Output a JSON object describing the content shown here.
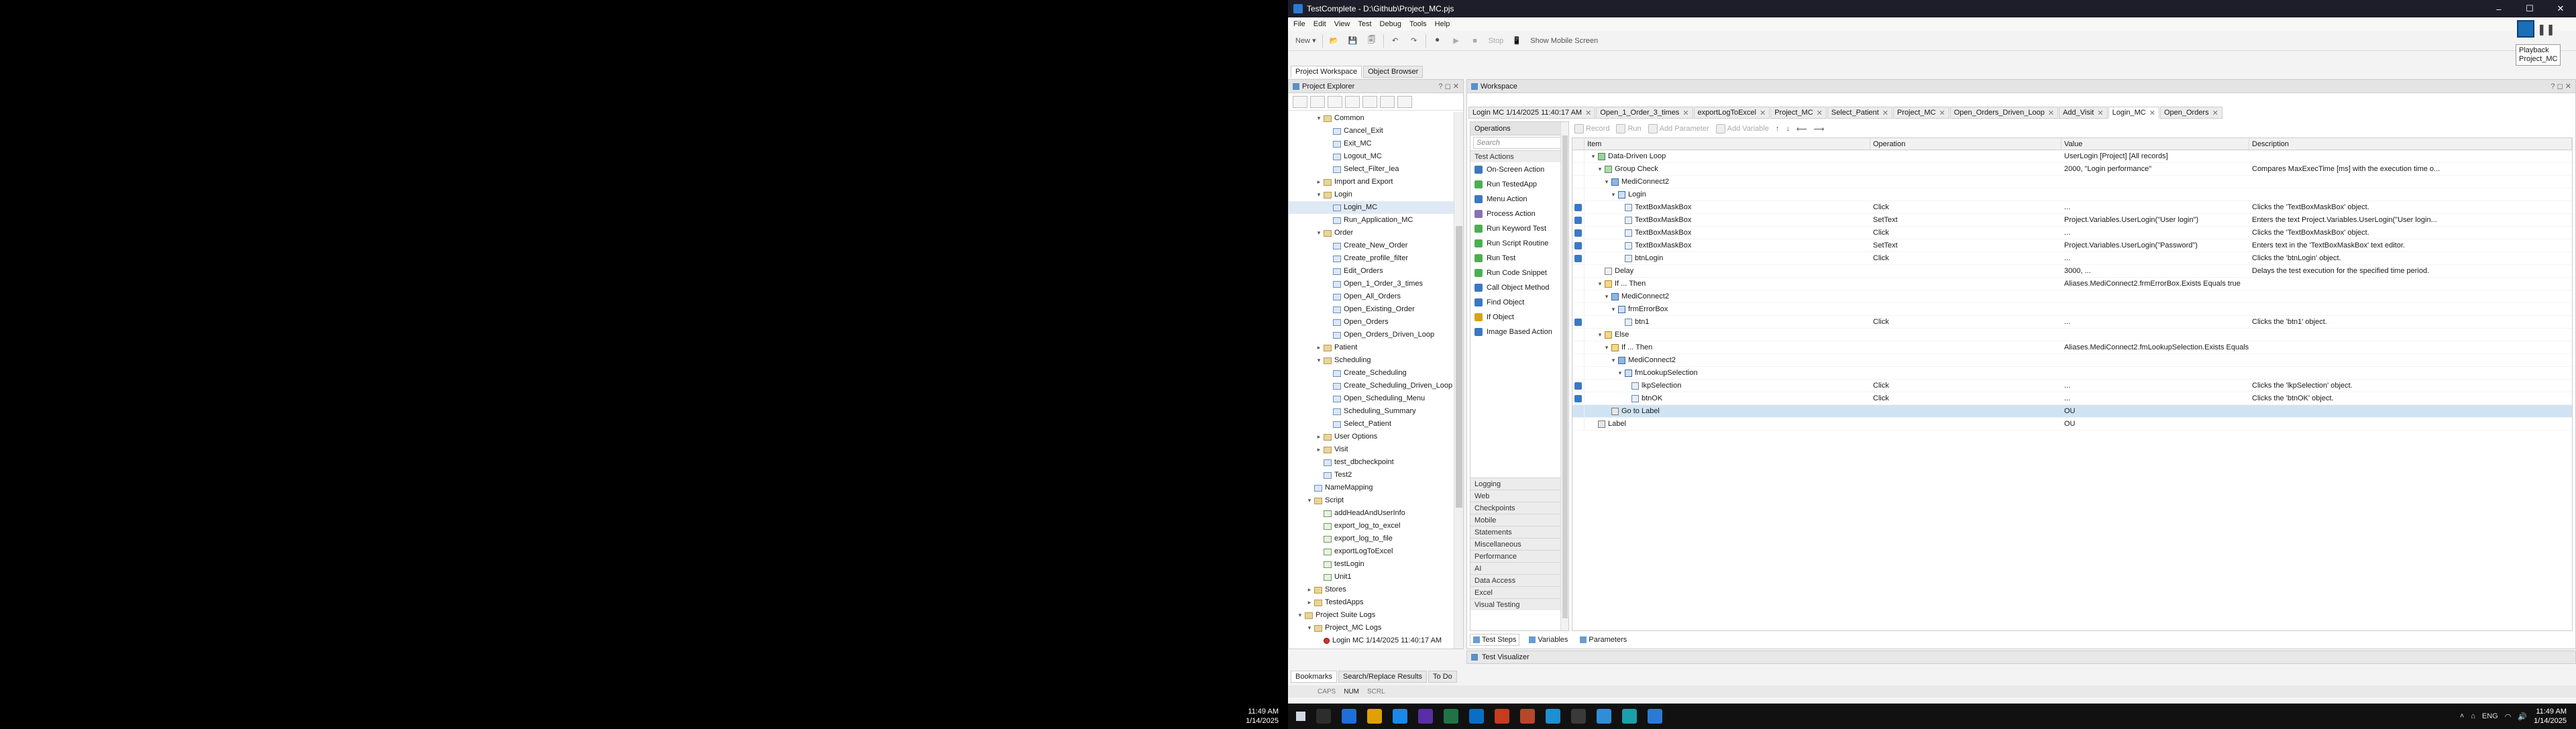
{
  "window": {
    "title": "TestComplete - D:\\Github\\Project_MC.pjs",
    "min": "–",
    "max": "☐",
    "close": "✕"
  },
  "menu": [
    "File",
    "Edit",
    "View",
    "Test",
    "Debug",
    "Tools",
    "Help"
  ],
  "toolbar": {
    "new_label": "New",
    "stop_label": "Stop",
    "show_mobile": "Show Mobile Screen"
  },
  "topright": {
    "playback": "Playback",
    "project": "Project_MC"
  },
  "workspace_tabs": [
    "Project Workspace",
    "Object Browser"
  ],
  "left_panel": {
    "title": "Project Explorer",
    "tree": [
      {
        "label": "Common",
        "depth": 1,
        "type": "fold",
        "arrow": "▾"
      },
      {
        "label": "Cancel_Exit",
        "depth": 2,
        "type": "item"
      },
      {
        "label": "Exit_MC",
        "depth": 2,
        "type": "item"
      },
      {
        "label": "Logout_MC",
        "depth": 2,
        "type": "item"
      },
      {
        "label": "Select_Filter_Iea",
        "depth": 2,
        "type": "item"
      },
      {
        "label": "Import and Export",
        "depth": 1,
        "type": "fold",
        "arrow": "▸"
      },
      {
        "label": "Login",
        "depth": 1,
        "type": "fold",
        "arrow": "▾"
      },
      {
        "label": "Login_MC",
        "depth": 2,
        "type": "item",
        "sel": true
      },
      {
        "label": "Run_Application_MC",
        "depth": 2,
        "type": "item"
      },
      {
        "label": "Order",
        "depth": 1,
        "type": "fold",
        "arrow": "▾"
      },
      {
        "label": "Create_New_Order",
        "depth": 2,
        "type": "item"
      },
      {
        "label": "Create_profile_filter",
        "depth": 2,
        "type": "item"
      },
      {
        "label": "Edit_Orders",
        "depth": 2,
        "type": "item"
      },
      {
        "label": "Open_1_Order_3_times",
        "depth": 2,
        "type": "item"
      },
      {
        "label": "Open_All_Orders",
        "depth": 2,
        "type": "item"
      },
      {
        "label": "Open_Existing_Order",
        "depth": 2,
        "type": "item"
      },
      {
        "label": "Open_Orders",
        "depth": 2,
        "type": "item"
      },
      {
        "label": "Open_Orders_Driven_Loop",
        "depth": 2,
        "type": "item"
      },
      {
        "label": "Patient",
        "depth": 1,
        "type": "fold",
        "arrow": "▸"
      },
      {
        "label": "Scheduling",
        "depth": 1,
        "type": "fold",
        "arrow": "▾"
      },
      {
        "label": "Create_Scheduling",
        "depth": 2,
        "type": "item"
      },
      {
        "label": "Create_Scheduling_Driven_Loop",
        "depth": 2,
        "type": "item"
      },
      {
        "label": "Open_Scheduling_Menu",
        "depth": 2,
        "type": "item"
      },
      {
        "label": "Scheduling_Summary",
        "depth": 2,
        "type": "item"
      },
      {
        "label": "Select_Patient",
        "depth": 2,
        "type": "item"
      },
      {
        "label": "User Options",
        "depth": 1,
        "type": "fold",
        "arrow": "▸"
      },
      {
        "label": "Visit",
        "depth": 1,
        "type": "fold",
        "arrow": "▸"
      },
      {
        "label": "test_dbcheckpoint",
        "depth": 1,
        "type": "item"
      },
      {
        "label": "Test2",
        "depth": 1,
        "type": "item"
      },
      {
        "label": "NameMapping",
        "depth": 0,
        "type": "item"
      },
      {
        "label": "Script",
        "depth": 0,
        "type": "fold",
        "arrow": "▾"
      },
      {
        "label": "addHeadAndUserInfo",
        "depth": 1,
        "type": "script"
      },
      {
        "label": "export_log_to_excel",
        "depth": 1,
        "type": "script"
      },
      {
        "label": "export_log_to_file",
        "depth": 1,
        "type": "script"
      },
      {
        "label": "exportLogToExcel",
        "depth": 1,
        "type": "script"
      },
      {
        "label": "testLogin",
        "depth": 1,
        "type": "script"
      },
      {
        "label": "Unit1",
        "depth": 1,
        "type": "script"
      },
      {
        "label": "Stores",
        "depth": 0,
        "type": "fold",
        "arrow": "▸"
      },
      {
        "label": "TestedApps",
        "depth": 0,
        "type": "fold",
        "arrow": "▸"
      },
      {
        "label": "Project Suite Logs",
        "depth": -1,
        "type": "fold",
        "arrow": "▾"
      },
      {
        "label": "Project_MC Logs",
        "depth": 0,
        "type": "fold",
        "arrow": "▾"
      },
      {
        "label": "Login MC 1/14/2025 11:40:17 AM",
        "depth": 1,
        "type": "log"
      }
    ]
  },
  "bottom_tabs": [
    "Bookmarks",
    "Search/Replace Results",
    "To Do"
  ],
  "status": [
    "CAPS",
    "NUM",
    "SCRL"
  ],
  "workspace": {
    "title": "Workspace",
    "doc_tabs": [
      {
        "label": "Login MC 1/14/2025 11:40:17 AM"
      },
      {
        "label": "Open_1_Order_3_times"
      },
      {
        "label": "exportLogToExcel"
      },
      {
        "label": "Project_MC"
      },
      {
        "label": "Select_Patient"
      },
      {
        "label": "Project_MC"
      },
      {
        "label": "Open_Orders_Driven_Loop"
      },
      {
        "label": "Add_Visit"
      },
      {
        "label": "Login_MC",
        "active": true
      },
      {
        "label": "Open_Orders"
      }
    ]
  },
  "operations": {
    "title": "Operations",
    "search_placeholder": "Search",
    "test_actions_label": "Test Actions",
    "items": [
      {
        "label": "On-Screen Action",
        "color": "#3a78c2"
      },
      {
        "label": "Run TestedApp",
        "color": "#4caf50"
      },
      {
        "label": "Menu Action",
        "color": "#3a78c2"
      },
      {
        "label": "Process Action",
        "color": "#8a6fb5"
      },
      {
        "label": "Run Keyword Test",
        "color": "#4caf50"
      },
      {
        "label": "Run Script Routine",
        "color": "#4caf50"
      },
      {
        "label": "Run Test",
        "color": "#4caf50"
      },
      {
        "label": "Run Code Snippet",
        "color": "#4caf50"
      },
      {
        "label": "Call Object Method",
        "color": "#3a78c2"
      },
      {
        "label": "Find Object",
        "color": "#3a78c2"
      },
      {
        "label": "If Object",
        "color": "#d6a21c"
      },
      {
        "label": "Image Based Action",
        "color": "#3a78c2"
      }
    ],
    "categories": [
      "Logging",
      "Web",
      "Checkpoints",
      "Mobile",
      "Statements",
      "Miscellaneous",
      "Performance",
      "AI",
      "Data Access",
      "Excel",
      "Visual Testing"
    ]
  },
  "test_toolbar": [
    "Record",
    "Run",
    "Add Parameter",
    "Add Variable"
  ],
  "grid": {
    "headers": [
      "Item",
      "Operation",
      "Value",
      "Description"
    ],
    "rows": [
      {
        "depth": 0,
        "arrow": "▾",
        "icon": "loop",
        "item": "Data-Driven Loop",
        "op": "",
        "value": "UserLogin [Project] [All records]",
        "desc": "",
        "mark": false
      },
      {
        "depth": 1,
        "arrow": "▾",
        "icon": "grp",
        "item": "Group Check",
        "op": "",
        "value": "2000, \"Login performance\"",
        "desc": "Compares MaxExecTime [ms] with the execution time o...",
        "mark": false
      },
      {
        "depth": 2,
        "arrow": "▾",
        "icon": "obj",
        "item": "MediConnect2",
        "op": "",
        "value": "",
        "desc": "",
        "mark": false
      },
      {
        "depth": 3,
        "arrow": "▾",
        "icon": "win",
        "item": "Login",
        "op": "",
        "value": "",
        "desc": "",
        "mark": false
      },
      {
        "depth": 4,
        "arrow": "",
        "icon": "ctl",
        "item": "TextBoxMaskBox",
        "op": "Click",
        "value": "...",
        "desc": "Clicks the 'TextBoxMaskBox' object.",
        "mark": true
      },
      {
        "depth": 4,
        "arrow": "",
        "icon": "ctl",
        "item": "TextBoxMaskBox",
        "op": "SetText",
        "value": "Project.Variables.UserLogin(\"User login\")",
        "desc": "Enters the text Project.Variables.UserLogin(\"User login...",
        "mark": true
      },
      {
        "depth": 4,
        "arrow": "",
        "icon": "ctl",
        "item": "TextBoxMaskBox",
        "op": "Click",
        "value": "...",
        "desc": "Clicks the 'TextBoxMaskBox' object.",
        "mark": true
      },
      {
        "depth": 4,
        "arrow": "",
        "icon": "ctl",
        "item": "TextBoxMaskBox",
        "op": "SetText",
        "value": "Project.Variables.UserLogin(\"Password\")",
        "desc": "Enters text in the 'TextBoxMaskBox' text editor.",
        "mark": true
      },
      {
        "depth": 4,
        "arrow": "",
        "icon": "ctl",
        "item": "btnLogin",
        "op": "Click",
        "value": "...",
        "desc": "Clicks the 'btnLogin' object.",
        "mark": true
      },
      {
        "depth": 1,
        "arrow": "",
        "icon": "delay",
        "item": "Delay",
        "op": "",
        "value": "3000, ...",
        "desc": "Delays the test execution for the specified time period.",
        "mark": false
      },
      {
        "depth": 1,
        "arrow": "▾",
        "icon": "ifi",
        "item": "If ... Then",
        "op": "",
        "value": "Aliases.MediConnect2.frmErrorBox.Exists Equals true",
        "desc": "",
        "mark": false
      },
      {
        "depth": 2,
        "arrow": "▾",
        "icon": "obj",
        "item": "MediConnect2",
        "op": "",
        "value": "",
        "desc": "",
        "mark": false
      },
      {
        "depth": 3,
        "arrow": "▾",
        "icon": "win",
        "item": "frmErrorBox",
        "op": "",
        "value": "",
        "desc": "",
        "mark": false
      },
      {
        "depth": 4,
        "arrow": "",
        "icon": "ctl",
        "item": "btn1",
        "op": "Click",
        "value": "...",
        "desc": "Clicks the 'btn1' object.",
        "mark": true
      },
      {
        "depth": 1,
        "arrow": "▾",
        "icon": "ifi",
        "item": "Else",
        "op": "",
        "value": "",
        "desc": "",
        "mark": false
      },
      {
        "depth": 2,
        "arrow": "▾",
        "icon": "ifi",
        "item": "If ... Then",
        "op": "",
        "value": "Aliases.MediConnect2.fmLookupSelection.Exists Equals...",
        "desc": "",
        "mark": false
      },
      {
        "depth": 3,
        "arrow": "▾",
        "icon": "obj",
        "item": "MediConnect2",
        "op": "",
        "value": "",
        "desc": "",
        "mark": false
      },
      {
        "depth": 4,
        "arrow": "▾",
        "icon": "win",
        "item": "fmLookupSelection",
        "op": "",
        "value": "",
        "desc": "",
        "mark": false
      },
      {
        "depth": 5,
        "arrow": "",
        "icon": "ctl",
        "item": "lkpSelection",
        "op": "Click",
        "value": "...",
        "desc": "Clicks the 'lkpSelection' object.",
        "mark": true
      },
      {
        "depth": 5,
        "arrow": "",
        "icon": "ctl",
        "item": "btnOK",
        "op": "Click",
        "value": "...",
        "desc": "Clicks the 'btnOK' object.",
        "mark": true
      },
      {
        "depth": 2,
        "arrow": "",
        "icon": "lbl",
        "item": "Go to Label",
        "op": "",
        "value": "OU",
        "desc": "",
        "mark": false,
        "hl": true
      },
      {
        "depth": 0,
        "arrow": "",
        "icon": "lbl",
        "item": "Label",
        "op": "",
        "value": "OU",
        "desc": "",
        "mark": false
      }
    ]
  },
  "ws_bottom_tabs": [
    "Test Steps",
    "Variables",
    "Parameters"
  ],
  "visualizer": "Test Visualizer",
  "taskbar": {
    "time": "11:49 AM",
    "date": "1/14/2025",
    "lang": "ENG",
    "apps": [
      "#2d2d2d",
      "#1e6fd9",
      "#e0a100",
      "#1b88e8",
      "#5a2ea6",
      "#217346",
      "#0a6ec7",
      "#c53c1e",
      "#b7472a",
      "#1e8fd0",
      "#3a3a3a",
      "#2f8ed8",
      "#1b9fa9",
      "#2b7bd6"
    ]
  }
}
